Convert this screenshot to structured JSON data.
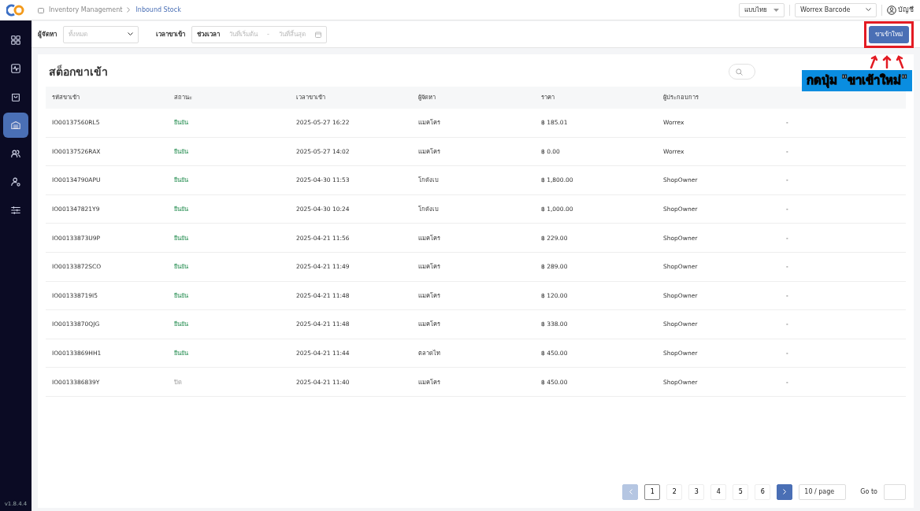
{
  "breadcrumb": [
    {
      "label": "Inventory Management",
      "current": false
    },
    {
      "label": "Inbound Stock",
      "current": true
    }
  ],
  "header": {
    "language": "แบบไทย",
    "store": "Worrex Barcode",
    "account": "บัญชี"
  },
  "sidebar": {
    "items": [
      {
        "selected": false
      },
      {
        "selected": false
      },
      {
        "selected": false
      },
      {
        "selected": true
      },
      {
        "selected": false
      },
      {
        "selected": false
      },
      {
        "selected": false
      }
    ],
    "version": "v1.8.4.4"
  },
  "filters": {
    "supplier_label": "ผู้จัดหา",
    "supplier_placeholder": "ทั้งหมด",
    "time_label": "เวลาขาเข้า",
    "range_label": "ช่วงเวลา",
    "start_placeholder": "วันที่เริ่มต้น",
    "separator": "-",
    "end_placeholder": "วันที่สิ้นสุด"
  },
  "new_button": "ขาเข้าใหม่",
  "title": "สต็อกขาเข้า",
  "table": {
    "columns": [
      "รหัสขาเข้า",
      "สถานะ",
      "เวลาขาเข้า",
      "ผู้จัดหา",
      "ราคา",
      "ผู้ประกอบการ"
    ],
    "rows": [
      {
        "code": "IO00137560RL5",
        "status": "ยืนยัน",
        "confirmed": true,
        "time": "2025-05-27 16:22",
        "supplier": "แมคโคร",
        "price": "฿ 185.01",
        "operator": "Worrex",
        "column_7": "-"
      },
      {
        "code": "IO00137526RAX",
        "status": "ยืนยัน",
        "confirmed": true,
        "time": "2025-05-27 14:02",
        "supplier": "แมคโคร",
        "price": "฿ 0.00",
        "operator": "Worrex",
        "column_7": "-"
      },
      {
        "code": "IO00134790APU",
        "status": "ยืนยัน",
        "confirmed": true,
        "time": "2025-04-30 11:53",
        "supplier": "โกดังเบ",
        "price": "฿ 1,800.00",
        "operator": "ShopOwner",
        "column_7": "-"
      },
      {
        "code": "IO001347821Y9",
        "status": "ยืนยัน",
        "confirmed": true,
        "time": "2025-04-30 10:24",
        "supplier": "โกดังเบ",
        "price": "฿ 1,000.00",
        "operator": "ShopOwner",
        "column_7": "-"
      },
      {
        "code": "IO00133873U9P",
        "status": "ยืนยัน",
        "confirmed": true,
        "time": "2025-04-21 11:56",
        "supplier": "แมคโคร",
        "price": "฿ 229.00",
        "operator": "ShopOwner",
        "column_7": "-"
      },
      {
        "code": "IO00133872SCO",
        "status": "ยืนยัน",
        "confirmed": true,
        "time": "2025-04-21 11:49",
        "supplier": "แมคโคร",
        "price": "฿ 289.00",
        "operator": "ShopOwner",
        "column_7": "-"
      },
      {
        "code": "IO001338719I5",
        "status": "ยืนยัน",
        "confirmed": true,
        "time": "2025-04-21 11:48",
        "supplier": "แมคโคร",
        "price": "฿ 120.00",
        "operator": "ShopOwner",
        "column_7": "-"
      },
      {
        "code": "IO00133870QJG",
        "status": "ยืนยัน",
        "confirmed": true,
        "time": "2025-04-21 11:48",
        "supplier": "แมคโคร",
        "price": "฿ 338.00",
        "operator": "ShopOwner",
        "column_7": "-"
      },
      {
        "code": "IO00133869HH1",
        "status": "ยืนยัน",
        "confirmed": true,
        "time": "2025-04-21 11:44",
        "supplier": "ตลาดไท",
        "price": "฿ 450.00",
        "operator": "ShopOwner",
        "column_7": "-"
      },
      {
        "code": "IO0013386839Y",
        "status": "ปิด",
        "confirmed": false,
        "time": "2025-04-21 11:40",
        "supplier": "แมคโคร",
        "price": "฿ 450.00",
        "operator": "ShopOwner",
        "column_7": "-"
      }
    ]
  },
  "pagination": {
    "prev_disabled": true,
    "next_disabled": false,
    "pages": [
      {
        "label": "1",
        "selected": true
      },
      {
        "label": "2",
        "selected": false
      },
      {
        "label": "3",
        "selected": false
      },
      {
        "label": "4",
        "selected": false
      },
      {
        "label": "5",
        "selected": false
      },
      {
        "label": "6",
        "selected": false
      }
    ],
    "page_size": "10 / page",
    "goto_label": "Go to"
  },
  "annotation": {
    "caption": "กดปุ่ม \"ขาเข้าใหม่\""
  }
}
